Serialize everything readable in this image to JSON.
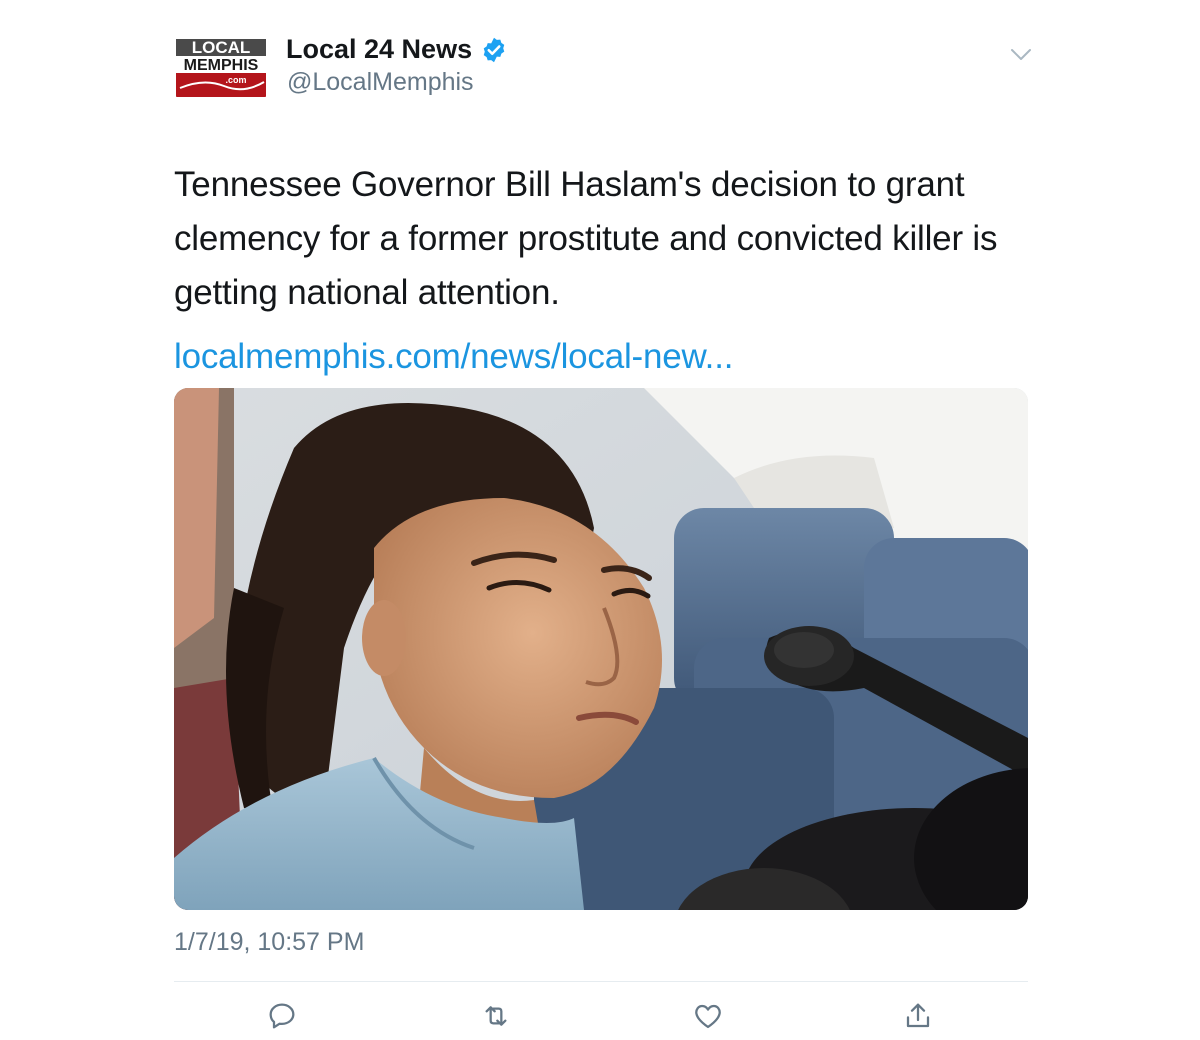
{
  "author": {
    "name": "Local 24 News",
    "handle": "@LocalMemphis",
    "logo_text_top": "LOCAL",
    "logo_text_mid": "MEMPHIS",
    "logo_text_bottom": ".com",
    "verified": true
  },
  "tweet": {
    "text": "Tennessee Governor Bill Haslam's decision to grant clemency for a former prostitute and convicted killer is getting national attention.",
    "link": "localmemphis.com/news/local-new...",
    "timestamp": "1/7/19, 10:57 PM"
  },
  "actions": [
    {
      "name": "reply",
      "icon": "reply-icon"
    },
    {
      "name": "retweet",
      "icon": "retweet-icon"
    },
    {
      "name": "like",
      "icon": "heart-icon"
    },
    {
      "name": "share",
      "icon": "share-icon"
    }
  ],
  "colors": {
    "link": "#1b95e0",
    "verified": "#1da1f2",
    "muted": "#657786",
    "logo_red": "#b4151b"
  }
}
